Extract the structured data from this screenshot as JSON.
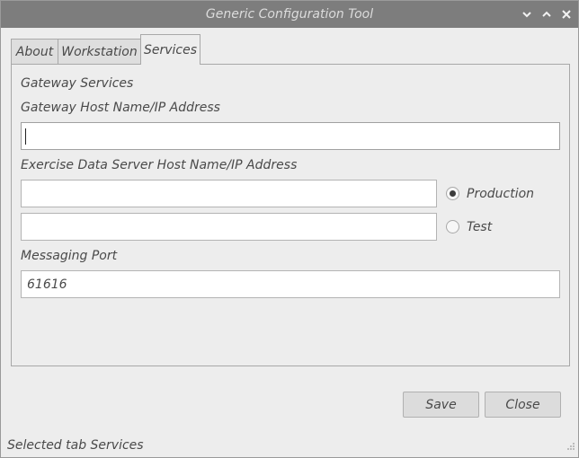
{
  "window": {
    "title": "Generic Configuration Tool",
    "controls": [
      "minimize-icon",
      "maximize-icon",
      "close-icon"
    ]
  },
  "tabs": [
    {
      "label": "About",
      "active": false
    },
    {
      "label": "Workstation",
      "active": false
    },
    {
      "label": "Services",
      "active": true
    }
  ],
  "services": {
    "section_title": "Gateway Services",
    "gateway_label": "Gateway Host Name/IP Address",
    "gateway_value": "",
    "exercise_label": "Exercise Data Server Host Name/IP Address",
    "production_value": "",
    "test_value": "",
    "radio_production": "Production",
    "radio_test": "Test",
    "selected_server": "Production",
    "port_label": "Messaging Port",
    "port_value": "61616"
  },
  "buttons": {
    "save": "Save",
    "close": "Close"
  },
  "status": {
    "text": "Selected tab Services"
  },
  "colors": {
    "titlebar": "#7d7d7d",
    "window_bg": "#ededed",
    "field_bg": "#ffffff"
  }
}
